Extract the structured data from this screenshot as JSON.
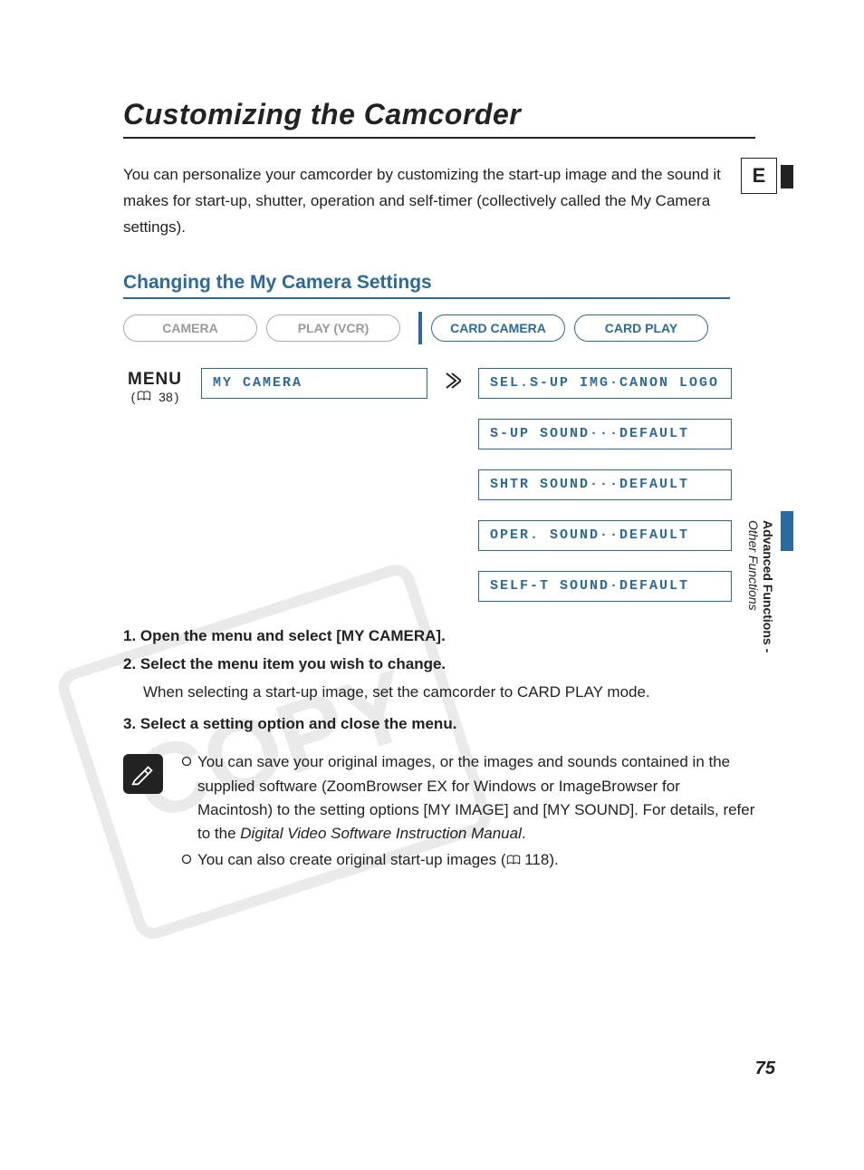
{
  "title": "Customizing the Camcorder",
  "intro": "You can personalize your camcorder by customizing the start-up image and the sound it makes for start-up, shutter, operation and self-timer (collectively called the My Camera settings).",
  "section_heading": "Changing the My Camera Settings",
  "modes": {
    "camera": "CAMERA",
    "play_vcr": "PLAY (VCR)",
    "card_camera": "CARD CAMERA",
    "card_play": "CARD PLAY"
  },
  "menu": {
    "label": "MENU",
    "ref_page": "38",
    "submenu": "MY CAMERA",
    "options": [
      "SEL.S-UP IMG·CANON LOGO",
      "S-UP SOUND···DEFAULT",
      "SHTR SOUND···DEFAULT",
      "OPER. SOUND··DEFAULT",
      "SELF-T SOUND·DEFAULT"
    ]
  },
  "steps": {
    "s1": "Open the menu and select [MY CAMERA].",
    "s2": "Select the menu item you wish to change.",
    "s2_note": "When selecting a start-up image, set the camcorder to CARD PLAY mode.",
    "s3": "Select a setting option and close the menu."
  },
  "info": {
    "b1_a": "You can save your original images, or the images and sounds contained in the supplied software (ZoomBrowser EX for Windows or ImageBrowser for Macintosh) to the setting options [MY IMAGE] and [MY SOUND]. For details, refer to the ",
    "b1_italic": "Digital Video Software Instruction Manual",
    "b1_c": ".",
    "b2_a": "You can also create original start-up images (",
    "b2_page": "118",
    "b2_c": ")."
  },
  "side": {
    "lang": "E",
    "bold": "Advanced Functions -",
    "italic": "Other Functions"
  },
  "page_number": "75"
}
